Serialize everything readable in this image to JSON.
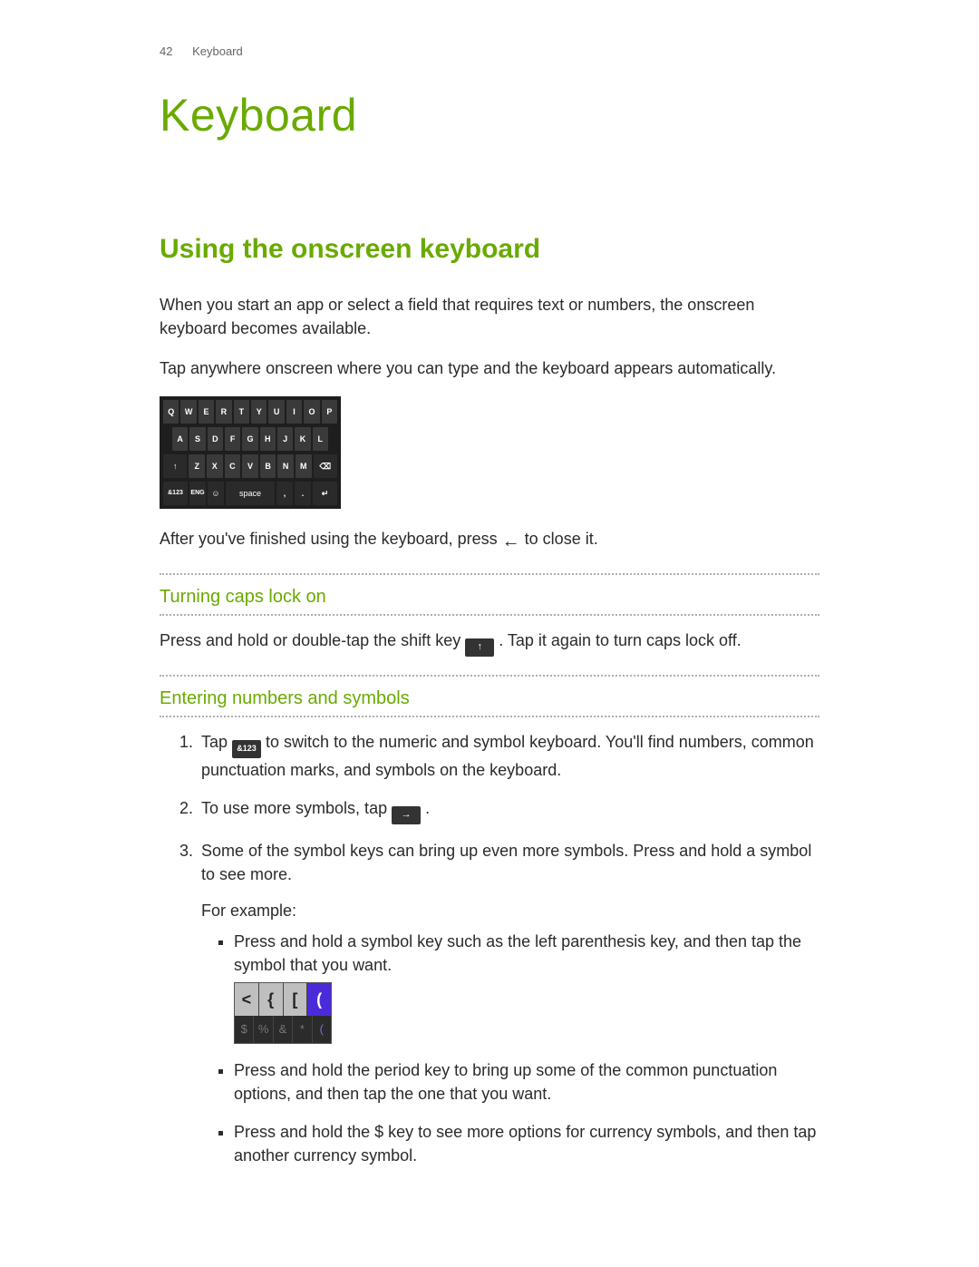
{
  "header": {
    "page_number": "42",
    "running_title": "Keyboard"
  },
  "title": "Keyboard",
  "section_heading": "Using the onscreen keyboard",
  "para_intro": "When you start an app or select a field that requires text or numbers, the onscreen keyboard becomes available.",
  "para_tap_anywhere": "Tap anywhere onscreen where you can type and the keyboard appears automatically.",
  "keyboard": {
    "row1": [
      "Q",
      "W",
      "E",
      "R",
      "T",
      "Y",
      "U",
      "I",
      "O",
      "P"
    ],
    "row2": [
      "A",
      "S",
      "D",
      "F",
      "G",
      "H",
      "J",
      "K",
      "L"
    ],
    "row3_shift": "↑",
    "row3": [
      "Z",
      "X",
      "C",
      "V",
      "B",
      "N",
      "M"
    ],
    "row3_backspace": "⌫",
    "row4_num": "&123",
    "row4_lang": "ENG",
    "row4_emoji": "☺",
    "row4_space": "space",
    "row4_comma": ",",
    "row4_period": ".",
    "row4_enter": "↵"
  },
  "after_close_pre": "After you've finished using the keyboard, press ",
  "after_close_icon": "←",
  "after_close_post": " to close it.",
  "caps_heading": "Turning caps lock on",
  "caps_pre": "Press and hold or double-tap the shift key ",
  "caps_icon": "↑",
  "caps_post": ". Tap it again to turn caps lock off.",
  "sym_heading": "Entering numbers and symbols",
  "steps": {
    "s1_pre": "Tap ",
    "s1_icon": "&123",
    "s1_post": " to switch to the numeric and symbol keyboard. You'll find numbers, common punctuation marks, and symbols on the keyboard.",
    "s2_pre": "To use more symbols, tap ",
    "s2_icon": "→",
    "s2_post": ".",
    "s3_a": "Some of the symbol keys can bring up even more symbols. Press and hold a symbol to see more.",
    "s3_example_label": "For example:",
    "s3_b1": "Press and hold a symbol key such as the left parenthesis key, and then tap the symbol that you want.",
    "s3_b2": "Press and hold the period key to bring up some of the common punctuation options, and then tap the one that you want.",
    "s3_b3": "Press and hold the $ key to see more options for currency symbols, and then tap another currency symbol."
  },
  "symbol_popup": {
    "top": [
      "<",
      "{",
      "[",
      "("
    ],
    "bottom": [
      "$",
      "%",
      "&",
      "*",
      "("
    ]
  }
}
